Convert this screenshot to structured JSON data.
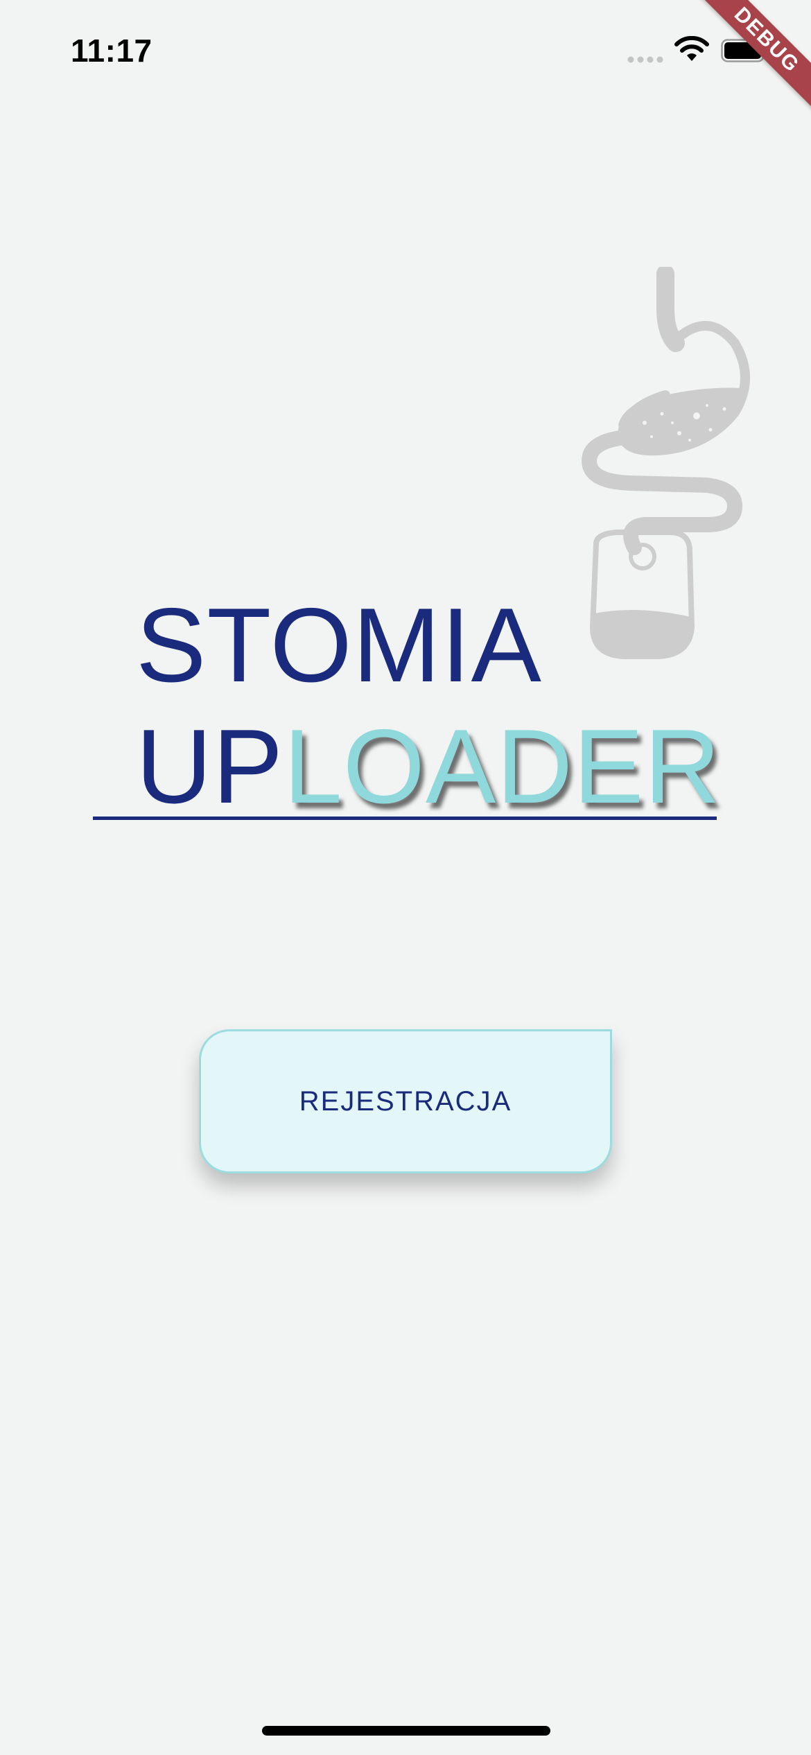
{
  "status_bar": {
    "time": "11:17"
  },
  "debug_banner": {
    "label": "DEBUG",
    "color": "#a8434a"
  },
  "illustration": {
    "icon": "digestive-system-stoma-icon",
    "color": "#cfcfcf"
  },
  "title": {
    "line1": "STOMIA",
    "line2_part1": "UP",
    "line2_part2": "LOADER",
    "primary_color": "#1a2a7c",
    "accent_color": "#8fd8db"
  },
  "register_button": {
    "label": "REJESTRACJA",
    "background": "#e3f7f8"
  },
  "colors": {
    "background": "#f2f3f3"
  }
}
